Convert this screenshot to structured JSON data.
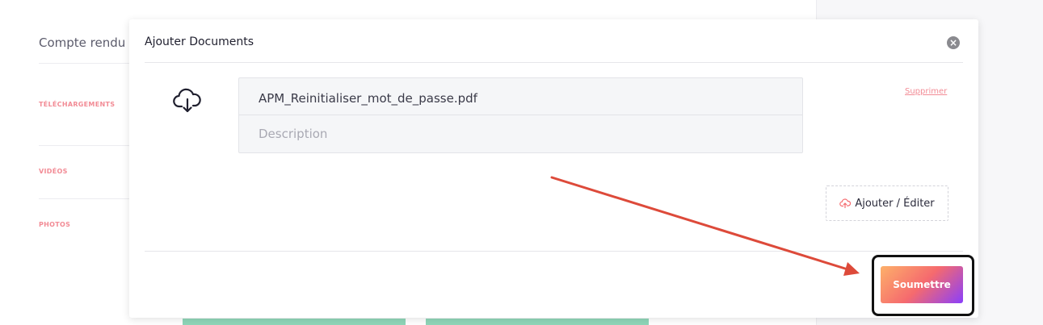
{
  "background": {
    "title": "Compte rendu",
    "sections": [
      "TÉLÉCHARGEMENTS",
      "VIDÉOS",
      "PHOTOS"
    ]
  },
  "modal": {
    "title": "Ajouter Documents",
    "close_icon": "close-icon",
    "file": {
      "name": "APM_Reinitialiser_mot_de_passe.pdf",
      "description_placeholder": "Description",
      "description_value": ""
    },
    "delete_label": "Supprimer",
    "add_edit_label": "Ajouter / Éditer",
    "submit_label": "Soumettre"
  },
  "colors": {
    "accent_pink": "#f28b95",
    "submit_gradient_start": "#fdb06a",
    "submit_gradient_end": "#8a3ffc",
    "arrow": "#dd4a3a"
  }
}
